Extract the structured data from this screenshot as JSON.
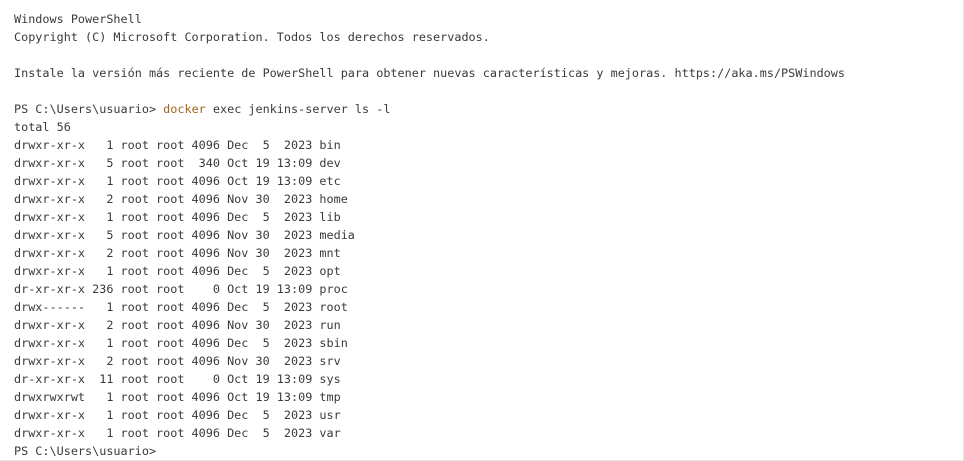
{
  "header": {
    "title_line": "Windows PowerShell",
    "copyright_line": "Copyright (C) Microsoft Corporation. Todos los derechos reservados.",
    "install_line": "Instale la versión más reciente de PowerShell para obtener nuevas características y mejoras. https://aka.ms/PSWindows"
  },
  "command": {
    "prompt": "PS C:\\Users\\usuario> ",
    "program": "docker",
    "args": " exec jenkins-server ls -l"
  },
  "output": {
    "total_line": "total 56",
    "entries": [
      "drwxr-xr-x   1 root root 4096 Dec  5  2023 bin",
      "drwxr-xr-x   5 root root  340 Oct 19 13:09 dev",
      "drwxr-xr-x   1 root root 4096 Oct 19 13:09 etc",
      "drwxr-xr-x   2 root root 4096 Nov 30  2023 home",
      "drwxr-xr-x   1 root root 4096 Dec  5  2023 lib",
      "drwxr-xr-x   5 root root 4096 Nov 30  2023 media",
      "drwxr-xr-x   2 root root 4096 Nov 30  2023 mnt",
      "drwxr-xr-x   1 root root 4096 Dec  5  2023 opt",
      "dr-xr-xr-x 236 root root    0 Oct 19 13:09 proc",
      "drwx------   1 root root 4096 Dec  5  2023 root",
      "drwxr-xr-x   2 root root 4096 Nov 30  2023 run",
      "drwxr-xr-x   1 root root 4096 Dec  5  2023 sbin",
      "drwxr-xr-x   2 root root 4096 Nov 30  2023 srv",
      "dr-xr-xr-x  11 root root    0 Oct 19 13:09 sys",
      "drwxrwxrwt   1 root root 4096 Oct 19 13:09 tmp",
      "drwxr-xr-x   1 root root 4096 Dec  5  2023 usr",
      "drwxr-xr-x   1 root root 4096 Dec  5  2023 var"
    ]
  },
  "final_prompt": "PS C:\\Users\\usuario>",
  "colors": {
    "background": "#ffffff",
    "text": "#3a3a3a",
    "command_highlight": "#a0651c"
  }
}
